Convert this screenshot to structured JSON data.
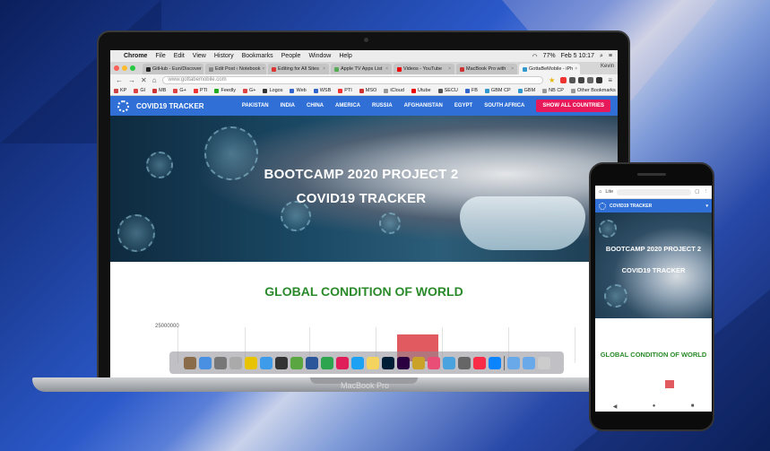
{
  "macos": {
    "menu": [
      "Chrome",
      "File",
      "Edit",
      "View",
      "History",
      "Bookmarks",
      "People",
      "Window",
      "Help"
    ],
    "battery": "77%",
    "clock": "Feb 5  10:17"
  },
  "browser": {
    "tabs": [
      "GitHub - Eun/Discover",
      "Edit Post ‹ Notebook",
      "Editing for All Sites",
      "Apple TV Apps List",
      "Videos - YouTube",
      "MacBook Pro with",
      "GottaBeMobile - iPh"
    ],
    "profile": "Kevin",
    "url": "www.gottabemobile.com",
    "bookmarks": [
      "KP",
      "GI",
      "MB",
      "G+",
      "PTI",
      "Feedly",
      "G+",
      "Logos",
      "Web",
      "WSB",
      "PTI",
      "MSO",
      "iCloud",
      "Utube",
      "SECU",
      "FB",
      "GBM CP",
      "GBM",
      "NB CP"
    ],
    "other_bookmarks": "Other Bookmarks"
  },
  "site": {
    "brand": "COVID19 TRACKER",
    "nav": [
      "PAKISTAN",
      "INDIA",
      "CHINA",
      "AMERICA",
      "RUSSIA",
      "AFGHANISTAN",
      "EGYPT",
      "SOUTH AFRICA"
    ],
    "show_all": "SHOW ALL COUNTRIES",
    "hero_line1": "BOOTCAMP 2020 PROJECT 2",
    "hero_line2": "COVID19 TRACKER",
    "section_title": "GLOBAL CONDITION OF WORLD",
    "chart_ymax": "25000000"
  },
  "laptop_label": "MacBook Pro",
  "phone": {
    "url_label": "Lite",
    "brand": "COVID19 TRACKER",
    "hero_line1": "BOOTCAMP 2020 PROJECT 2",
    "hero_line2": "COVID19 TRACKER",
    "section_title": "GLOBAL CONDITION OF WORLD"
  }
}
